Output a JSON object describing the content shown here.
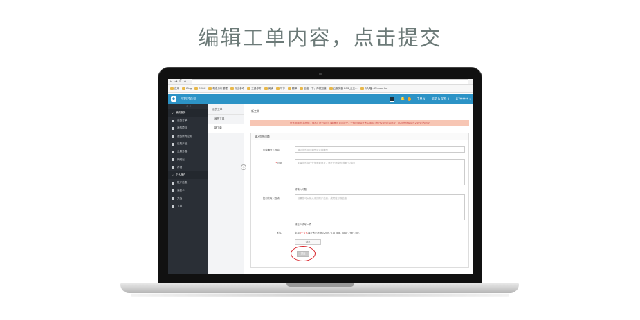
{
  "headline": "编辑工单内容，点击提交",
  "browser": {
    "nav_symbols": [
      "←",
      "→",
      "C",
      "⌂"
    ],
    "bookmarks": [
      {
        "label": "应用"
      },
      {
        "label": "Bing"
      },
      {
        "label": "ECOC"
      },
      {
        "label": "概念分析整理"
      },
      {
        "label": "写出参考"
      },
      {
        "label": "工具参考"
      },
      {
        "label": "阅读"
      },
      {
        "label": "写作"
      },
      {
        "label": "翻译"
      },
      {
        "label": "百度一下，你就知道"
      },
      {
        "label": "云服务器 ECS_云主..."
      },
      {
        "label": "价为喵 - Wunderlist"
      }
    ]
  },
  "app": {
    "title": "控制台首页",
    "header_right": [
      "工单 ∨",
      "帮助 & 文档 ∨",
      "8i7****** ∨"
    ]
  },
  "sidebar": {
    "collapse": "< <",
    "groups": [
      {
        "label": "我的服务",
        "items": [
          "我的订单",
          "我的项目",
          "我的所有应用",
          "已购产品",
          "云服务器",
          "网络出",
          "存储"
        ]
      },
      {
        "label": "个人账户",
        "items": [
          "账户信息",
          "我的卡",
          "充值",
          "工单"
        ]
      }
    ]
  },
  "subnav": {
    "title": "我的工单",
    "items": [
      "我的工单",
      "新工单"
    ]
  },
  "content": {
    "page_title": "新工单",
    "notice": "所有问题(包括系统、商品）进行中的订单)即可点击提交，一般问题会在大中国区工作日24小时内回复，80%的信息会在24小时内回复",
    "panel_title": "输入您的问题",
    "form": {
      "order_label": "订单编号（选填）",
      "order_placeholder": "输入您的项目编号或订单编号",
      "question_label": "问题",
      "question_required": "*",
      "question_placeholder": "如果您的存在任何需要回复，请在下面'如何获取'中填写",
      "question_hint": "请输入问题",
      "info_label": "如何获取（选填）",
      "info_placeholder": "设置您可以输入你的账户信息，成员账号等信息",
      "info_hint": "请至少填写一项",
      "attach_label": "附件",
      "attach_hint_a": "支持",
      "attach_hint_b": "3个文件",
      "attach_hint_c": "每个大小不超过20M,支持 'jpg', 'png', 'rar','zip'.",
      "upload_button": "浏览",
      "submit_button": "提交"
    }
  }
}
